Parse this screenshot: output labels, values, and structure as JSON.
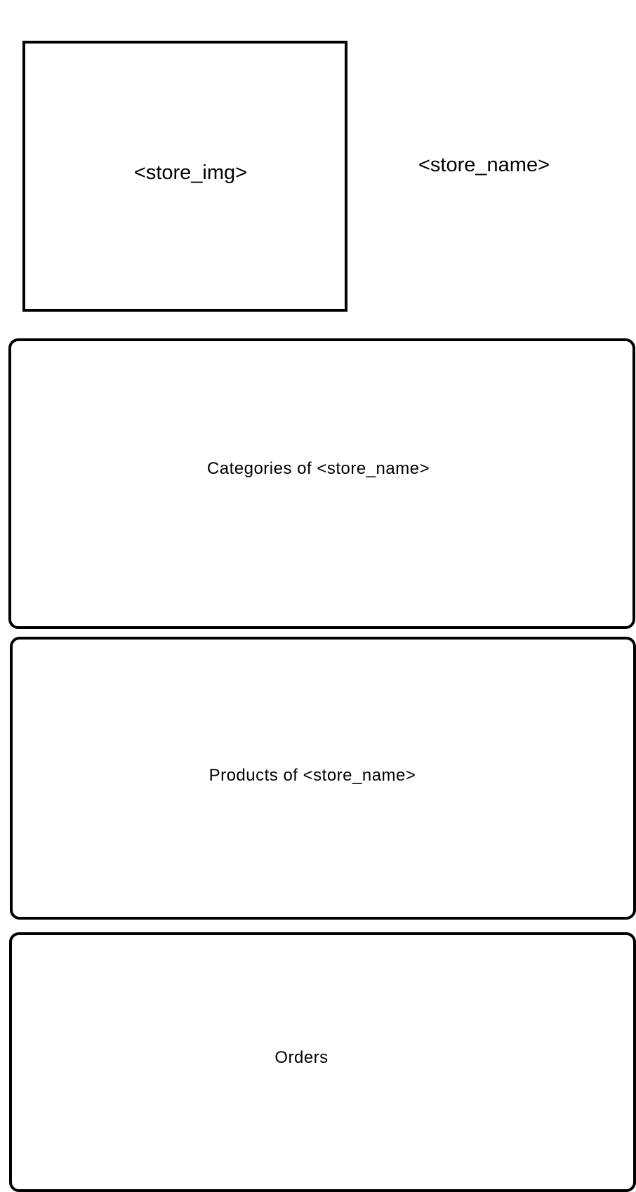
{
  "header": {
    "store_img_placeholder": "<store_img>",
    "store_name_placeholder": "<store_name>"
  },
  "sections": {
    "categories_label": "Categories of <store_name>",
    "products_label": "Products of <store_name>",
    "orders_label": "Orders"
  }
}
